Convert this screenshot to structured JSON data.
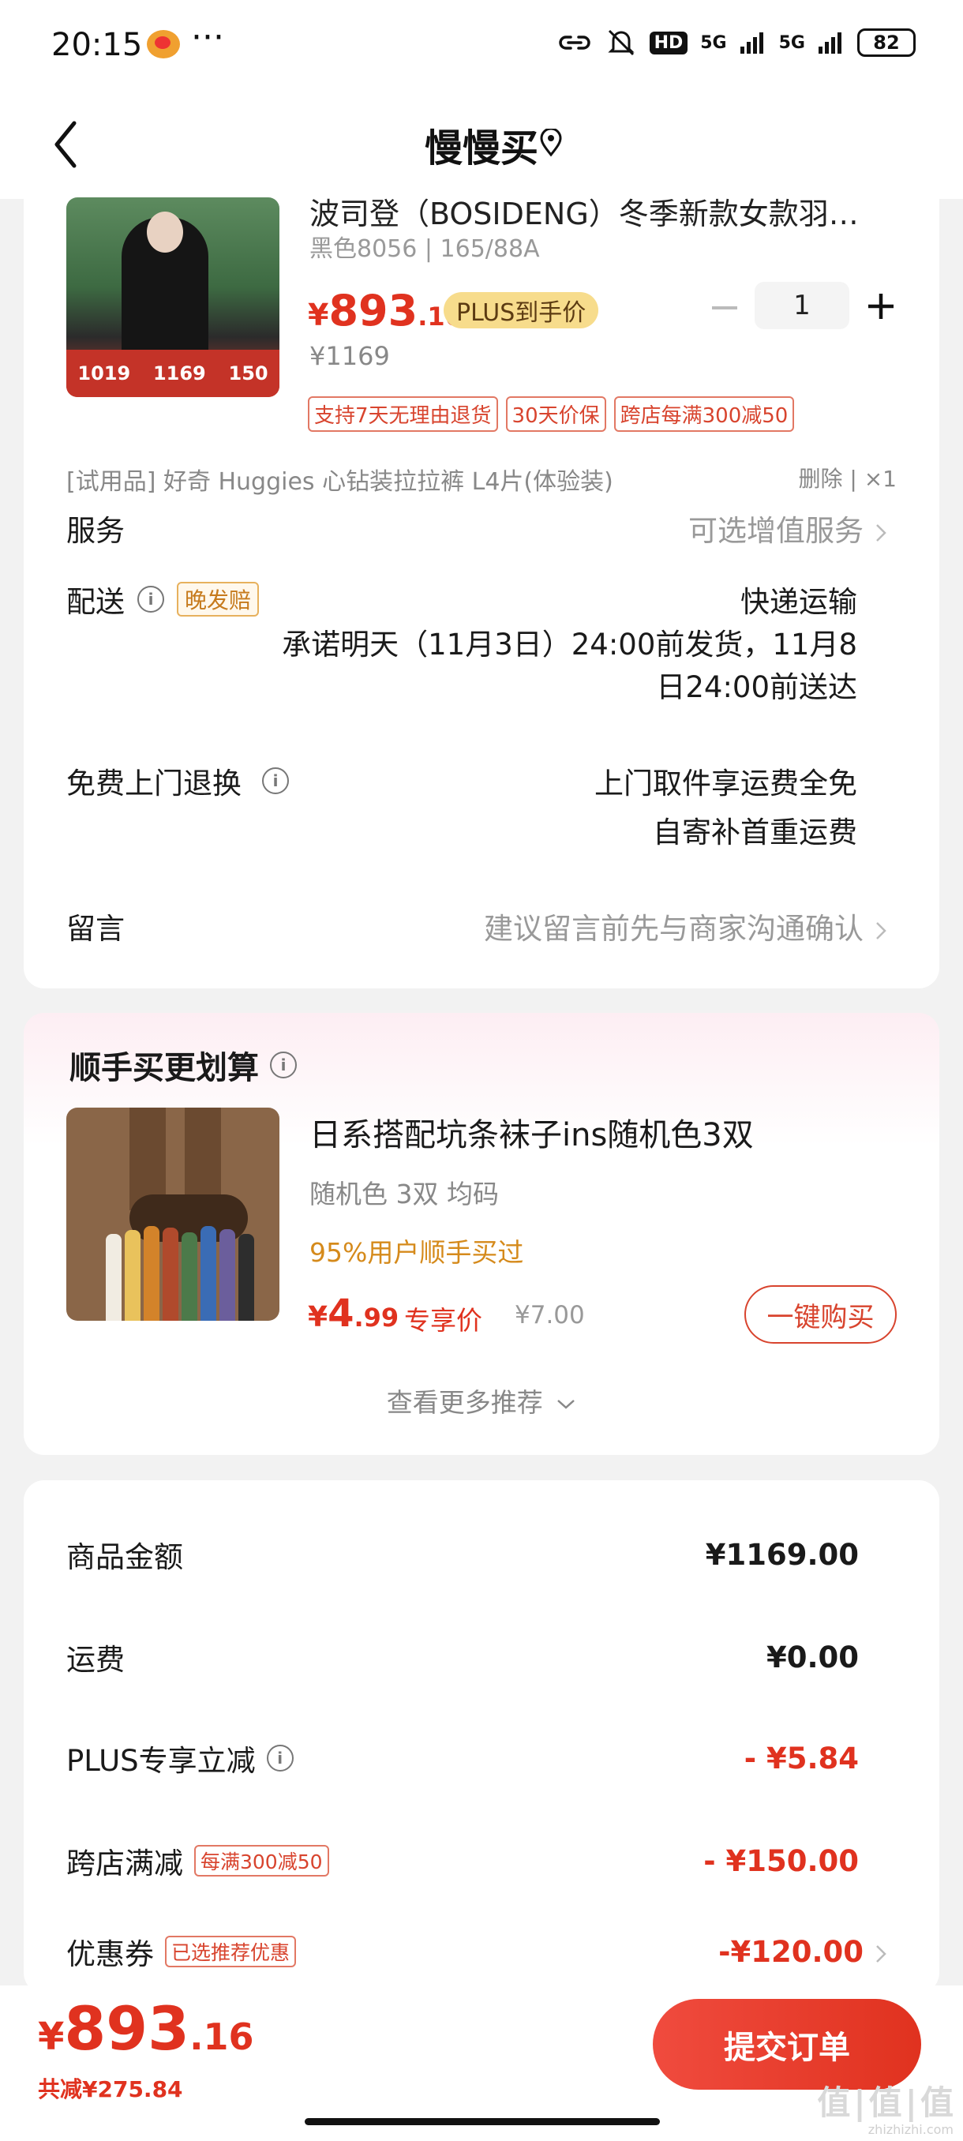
{
  "status_bar": {
    "time": "20:15",
    "dots": "···",
    "network_hd": "HD",
    "signal_1": "5G",
    "signal_2": "5G",
    "battery": "82"
  },
  "nav": {
    "title": "慢慢买",
    "icons": [
      "back-icon",
      "location-icon"
    ]
  },
  "product": {
    "title": "波司登（BOSIDENG）冬季新款女款羽…",
    "spec": "黑色8056 | 165/88A",
    "price_symbol": "¥",
    "price_int": "893",
    "price_dec": ".16",
    "plus_tag": "PLUS到手价",
    "original_price": "¥1169",
    "quantity": "1",
    "image_banner": [
      "1019",
      "1169",
      "150"
    ],
    "tags": [
      "支持7天无理由退货",
      "30天价保",
      "跨店每满300减50"
    ],
    "trial_item": "[试用品]   好奇 Huggies 心钻装拉拉裤 L4片(体验装)",
    "trial_action": "删除 | ×1"
  },
  "rows": {
    "service_label": "服务",
    "service_value": "可选增值服务",
    "delivery_label": "配送",
    "delivery_tag": "晚发赔",
    "delivery_method": "快递运输",
    "delivery_promise_1": "承诺明天（11月3日）24:00前发货，11月8",
    "delivery_promise_2": "日24:00前送达",
    "return_label": "免费上门退换",
    "return_value_1": "上门取件享运费全免",
    "return_value_2": "自寄补首重运费",
    "message_label": "留言",
    "message_placeholder": "建议留言前先与商家沟通确认"
  },
  "recommend": {
    "title": "顺手买更划算",
    "name": "日系搭配坑条袜子ins随机色3双",
    "spec": "随机色 3双    均码",
    "bought": "95%用户顺手买过",
    "price_symbol": "¥",
    "price_int": "4",
    "price_dec": ".99",
    "exclusive": "专享价",
    "original_price": "¥7.00",
    "buy_button": "一键购买",
    "more": "查看更多推荐"
  },
  "summary": {
    "items": [
      {
        "label": "商品金额",
        "value": "¥1169.00"
      },
      {
        "label": "运费",
        "value": "¥0.00"
      },
      {
        "label": "PLUS专享立减",
        "value": "- ¥5.84"
      },
      {
        "label": "跨店满减",
        "tag": "每满300减50",
        "value": "- ¥150.00"
      },
      {
        "label": "优惠券",
        "tag": "已选推荐优惠",
        "value": "-¥120.00"
      }
    ]
  },
  "bottom": {
    "price_symbol": "¥",
    "price_int": "893",
    "price_dec": ".16",
    "saving": "共减¥275.84",
    "submit": "提交订单"
  },
  "watermark": {
    "main": "值|值|值",
    "sub": "zhizhizhi.com"
  },
  "colors": {
    "accent_red": "#e0321f",
    "plus_gold": "#f7dc8c",
    "bought_orange": "#d58a1b"
  }
}
